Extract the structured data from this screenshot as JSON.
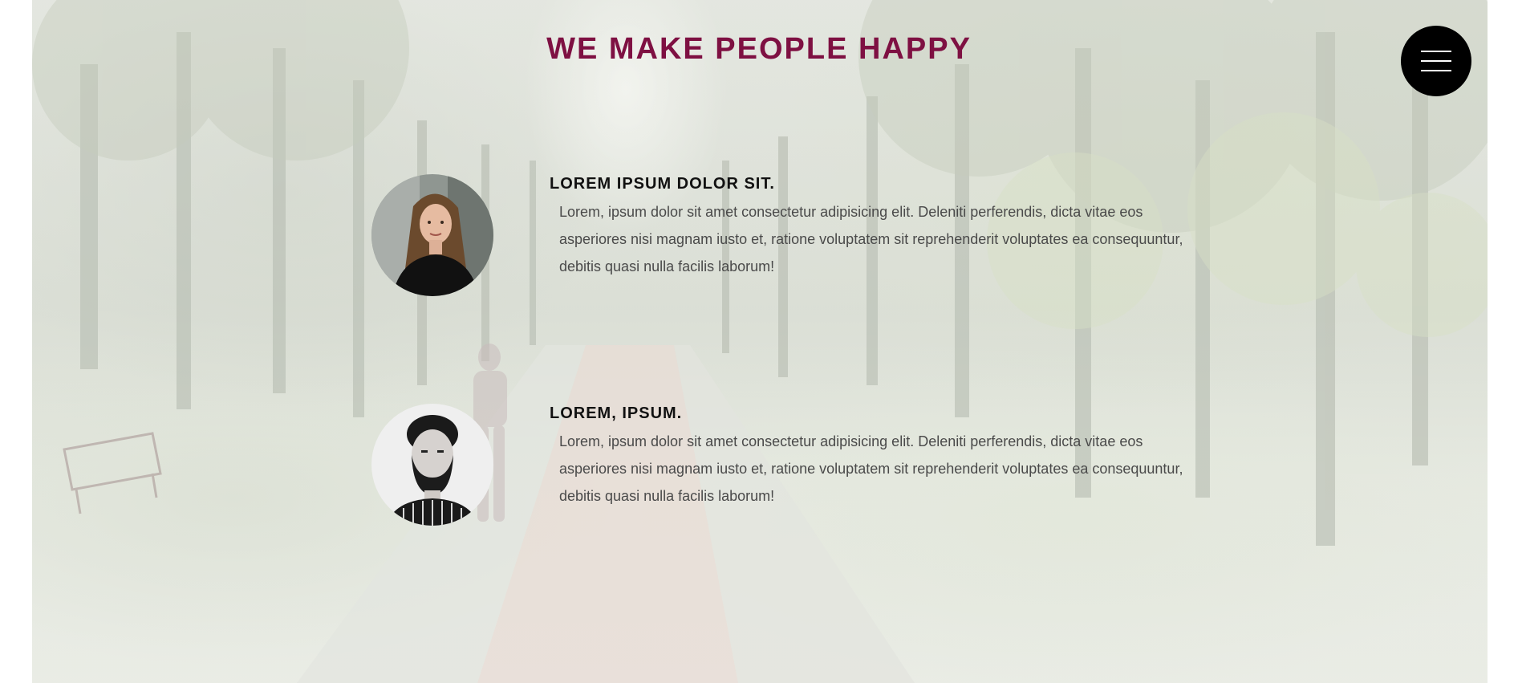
{
  "page": {
    "title": "WE MAKE PEOPLE HAPPY",
    "accent_color": "#7e1042"
  },
  "menu": {
    "icon": "hamburger-menu-icon"
  },
  "testimonials": [
    {
      "heading": "LOREM IPSUM DOLOR SIT.",
      "text": "Lorem, ipsum dolor sit amet consectetur adipisicing elit. Deleniti perferendis, dicta vitae eos asperiores nisi magnam iusto et, ratione voluptatem sit reprehenderit voluptates ea consequuntur, debitis quasi nulla facilis laborum!",
      "avatar": "woman-portrait"
    },
    {
      "heading": "LOREM, IPSUM.",
      "text": "Lorem, ipsum dolor sit amet consectetur adipisicing elit. Deleniti perferendis, dicta vitae eos asperiores nisi magnam iusto et, ratione voluptatem sit reprehenderit voluptates ea consequuntur, debitis quasi nulla facilis laborum!",
      "avatar": "bearded-man-portrait"
    }
  ]
}
